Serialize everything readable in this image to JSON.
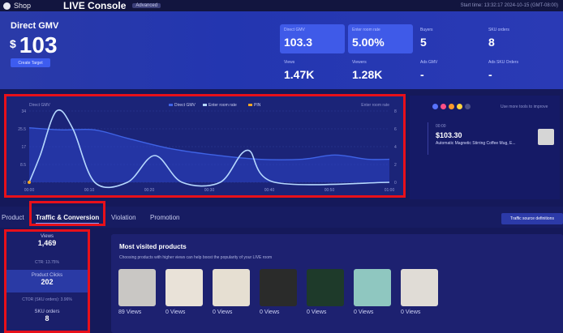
{
  "topbar": {
    "shop": "Shop",
    "console": "LIVE Console",
    "badge": "Advanced",
    "time": "Start time: 13:32:17 2024-10-15 (GMT-08:00)"
  },
  "hero": {
    "gmv_label": "Direct GMV",
    "gmv_currency": "$",
    "gmv_value": "103",
    "create_target": "Create Target",
    "metrics": [
      {
        "label": "Direct GMV",
        "value": "103.3",
        "selected": true
      },
      {
        "label": "Enter room rate",
        "value": "5.00%",
        "selected": true
      },
      {
        "label": "Buyers",
        "value": "5",
        "selected": false
      },
      {
        "label": "SKU orders",
        "value": "8",
        "selected": false
      },
      {
        "label": "Views",
        "value": "1.47K",
        "selected": false
      },
      {
        "label": "Viewers",
        "value": "1.28K",
        "selected": false
      },
      {
        "label": "Ads GMV",
        "value": "-",
        "selected": false
      },
      {
        "label": "Ads SKU Orders",
        "value": "-",
        "selected": false
      }
    ]
  },
  "chart_data": {
    "type": "line",
    "title": "",
    "legend": [
      "Direct GMV",
      "Enter room rate",
      "PIN"
    ],
    "left_axis_title": "Direct GMV",
    "right_axis_title": "Enter room rate",
    "x": [
      "00:00",
      "00:10",
      "00:20",
      "00:30",
      "00:40",
      "00:50",
      "01:00"
    ],
    "yticks_left": [
      "0",
      "8.5",
      "17",
      "25.5",
      "34"
    ],
    "yticks_right": [
      "0",
      "2",
      "4",
      "6",
      "8"
    ],
    "ylim_left": [
      0,
      34
    ],
    "ylim_right": [
      0,
      8
    ],
    "series": [
      {
        "name": "Direct GMV",
        "axis": "left",
        "color": "#3f63e6",
        "points": [
          [
            0,
            26
          ],
          [
            6,
            25
          ],
          [
            12,
            25
          ],
          [
            18,
            21
          ],
          [
            26,
            16
          ],
          [
            34,
            13
          ],
          [
            42,
            11
          ],
          [
            50,
            11
          ],
          [
            56,
            13
          ],
          [
            62,
            11
          ],
          [
            66,
            11
          ]
        ]
      },
      {
        "name": "Enter room rate",
        "axis": "right",
        "color": "#b6d8ff",
        "points": [
          [
            0,
            0
          ],
          [
            2,
            3
          ],
          [
            5,
            8
          ],
          [
            8,
            6
          ],
          [
            12,
            0
          ],
          [
            18,
            0
          ],
          [
            23,
            3
          ],
          [
            28,
            0
          ],
          [
            35,
            0
          ],
          [
            40,
            3.6
          ],
          [
            45,
            0
          ],
          [
            66,
            0
          ]
        ]
      }
    ],
    "pin": {
      "x": 0,
      "y": 0,
      "color": "#f5a623"
    }
  },
  "rightpanel": {
    "hint": "Use more tools to improve",
    "time": "00:00",
    "price": "$103.30",
    "title": "Automatic Magnetic Stirring Coffee Mug, E..."
  },
  "tabs": [
    "Product",
    "Traffic & Conversion",
    "Violation",
    "Promotion"
  ],
  "traffic_btn": "Traffic source definitions",
  "left_stats": {
    "views_label": "Views",
    "views_value": "1,469",
    "ctr": "CTR: 13.75%",
    "clicks_label": "Product Clicks",
    "clicks_value": "202",
    "ctor": "CTOR (SKU orders): 3.96%",
    "sku_label": "SKU orders",
    "sku_value": "8"
  },
  "most_visited": {
    "title": "Most visited products",
    "desc": "Choosing products with higher views can help boost the popularity of your LIVE room",
    "products": [
      {
        "views": "89 Views",
        "color": "#c9c7c4"
      },
      {
        "views": "0 Views",
        "color": "#e9e2d8"
      },
      {
        "views": "0 Views",
        "color": "#e6dfd2"
      },
      {
        "views": "0 Views",
        "color": "#2a2b2a"
      },
      {
        "views": "0 Views",
        "color": "#1e3a2a"
      },
      {
        "views": "0 Views",
        "color": "#8fc7c0"
      },
      {
        "views": "0 Views",
        "color": "#e0dcd6"
      }
    ]
  }
}
